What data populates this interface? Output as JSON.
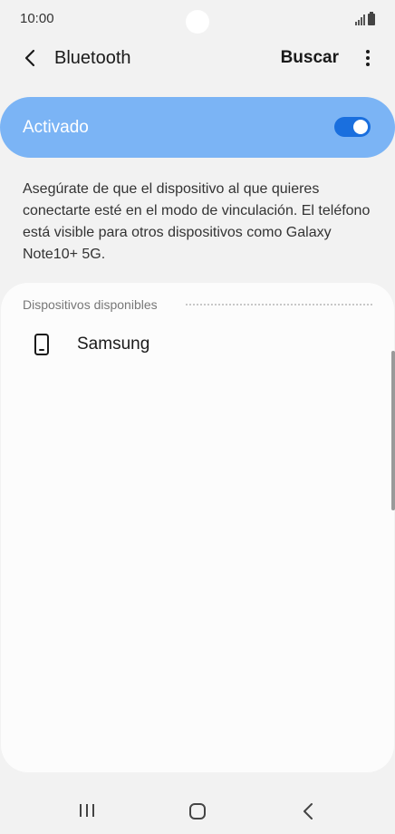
{
  "status_bar": {
    "time": "10:00"
  },
  "app_bar": {
    "title": "Bluetooth",
    "search_label": "Buscar"
  },
  "toggle": {
    "label": "Activado",
    "state": "on"
  },
  "description": "Asegúrate de que el dispositivo al que quieres conectarte esté en el modo de vinculación. El teléfono está visible para otros dispositivos como Galaxy Note10+ 5G.",
  "available": {
    "header": "Dispositivos disponibles",
    "devices": [
      {
        "name": "Samsung",
        "icon": "phone-icon"
      }
    ]
  },
  "colors": {
    "accent": "#1a6fde",
    "toggle_bar": "#7bb4f5",
    "background": "#f2f2f2"
  }
}
